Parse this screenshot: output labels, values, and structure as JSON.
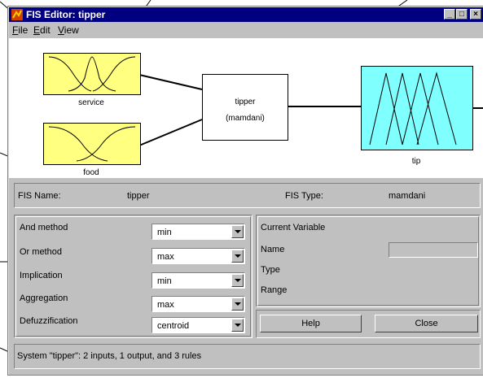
{
  "window": {
    "title": "FIS Editor: tipper",
    "controls": [
      "_",
      "□",
      "×"
    ]
  },
  "menu": [
    {
      "label": "File",
      "key": "F",
      "rest": "ile"
    },
    {
      "label": "Edit",
      "key": "E",
      "rest": "dit"
    },
    {
      "label": "View",
      "key": "V",
      "rest": "iew"
    }
  ],
  "diagram": {
    "inputs": [
      "service",
      "food"
    ],
    "system_name": "tipper",
    "system_type": "(mamdani)",
    "output": "tip"
  },
  "info": {
    "fis_name_label": "FIS Name:",
    "fis_name": "tipper",
    "fis_type_label": "FIS Type:",
    "fis_type": "mamdani"
  },
  "methods": [
    {
      "label": "And method",
      "value": "min"
    },
    {
      "label": "Or method",
      "value": "max"
    },
    {
      "label": "Implication",
      "value": "min"
    },
    {
      "label": "Aggregation",
      "value": "max"
    },
    {
      "label": "Defuzzification",
      "value": "centroid"
    }
  ],
  "current_variable": {
    "header": "Current Variable",
    "name_label": "Name",
    "name_value": "",
    "type_label": "Type",
    "range_label": "Range"
  },
  "buttons": {
    "help": "Help",
    "close": "Close"
  },
  "status": "System \"tipper\": 2 inputs, 1 output, and 3 rules",
  "colors": {
    "input_fill": "#ffff80",
    "output_fill": "#80ffff",
    "titlebar": "#000080",
    "face": "#c0c0c0"
  }
}
